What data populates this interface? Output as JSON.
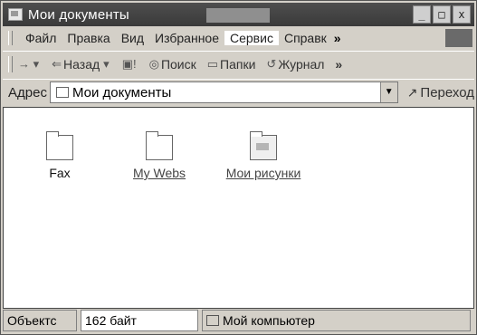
{
  "window": {
    "title": "Мои документы",
    "controls": [
      "_",
      "□",
      "x"
    ]
  },
  "menu": {
    "items": [
      "Файл",
      "Правка",
      "Вид",
      "Избранное",
      "Сервис",
      "Справк"
    ],
    "overflow": "»"
  },
  "toolbar": {
    "back": "Назад",
    "search": "Поиск",
    "folders": "Папки",
    "history": "Журнал",
    "overflow": "»"
  },
  "address": {
    "label": "Адрес",
    "value": "Мои документы",
    "go": "Переход"
  },
  "files": [
    {
      "name": "Fax",
      "icon": "folder-icon"
    },
    {
      "name": "My Webs",
      "icon": "folder-icon"
    },
    {
      "name": "Мои рисунки",
      "icon": "pictures-folder-icon"
    }
  ],
  "status": {
    "objects": "Объектс",
    "size": "162 байт",
    "location": "Мой компьютер"
  }
}
